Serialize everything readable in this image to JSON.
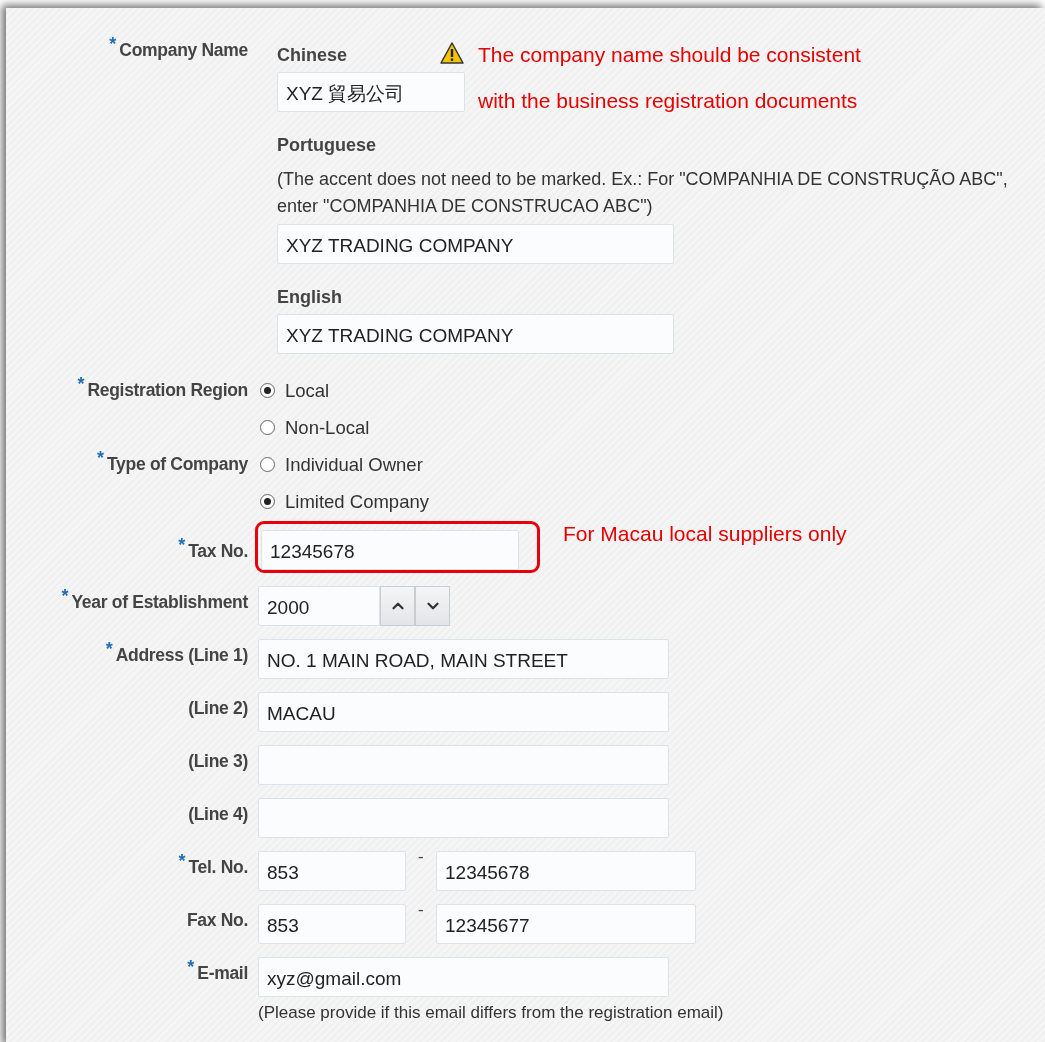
{
  "fields": [
    {
      "kind": "multilang",
      "label": "Company Name",
      "marker": "*",
      "annotation": {
        "kind": "warning",
        "lines": [
          "The company name should be consistent",
          "with the business registration documents"
        ]
      },
      "subfields": [
        {
          "heading": "Chinese",
          "value": "XYZ 貿易公司"
        },
        {
          "heading": "Portuguese",
          "note": "(The accent does not need to be marked. Ex.: For \"COMPANHIA DE CONSTRUÇÃO ABC\", enter \"COMPANHIA DE CONSTRUCAO ABC\")",
          "value": "XYZ TRADING COMPANY"
        },
        {
          "heading": "English",
          "value": "XYZ TRADING COMPANY"
        }
      ]
    },
    {
      "kind": "radio",
      "label": "Registration Region",
      "marker": "*",
      "options": [
        {
          "label": "Local",
          "selected": true
        },
        {
          "label": "Non-Local",
          "selected": false
        }
      ]
    },
    {
      "kind": "radio",
      "label": "Type of Company",
      "marker": "*",
      "options": [
        {
          "label": "Individual Owner",
          "selected": false
        },
        {
          "label": "Limited Company",
          "selected": true
        }
      ]
    },
    {
      "kind": "text",
      "label": "Tax No.",
      "marker": "*",
      "value": "12345678",
      "highlighted": true,
      "annotation": {
        "kind": "note",
        "lines": [
          "For Macau local suppliers only"
        ]
      }
    },
    {
      "kind": "spinner",
      "label": "Year of Establishment",
      "marker": "*",
      "value": "2000"
    },
    {
      "kind": "text",
      "label": "Address (Line 1)",
      "marker": "*",
      "value": "NO. 1 MAIN ROAD, MAIN STREET"
    },
    {
      "kind": "text",
      "label": "(Line 2)",
      "value": "MACAU"
    },
    {
      "kind": "text",
      "label": "(Line 3)"
    },
    {
      "kind": "text",
      "label": "(Line 4)"
    },
    {
      "kind": "phone",
      "label": "Tel. No.",
      "marker": "*",
      "values": [
        "853",
        "12345678"
      ],
      "separator": "-"
    },
    {
      "kind": "phone",
      "label": "Fax No.",
      "values": [
        "853",
        "12345677"
      ],
      "separator": "-"
    },
    {
      "kind": "text",
      "label": "E-mail",
      "marker": "*",
      "value": "xyz@gmail.com",
      "hint": "(Please provide if this email differs from the registration email)"
    }
  ]
}
